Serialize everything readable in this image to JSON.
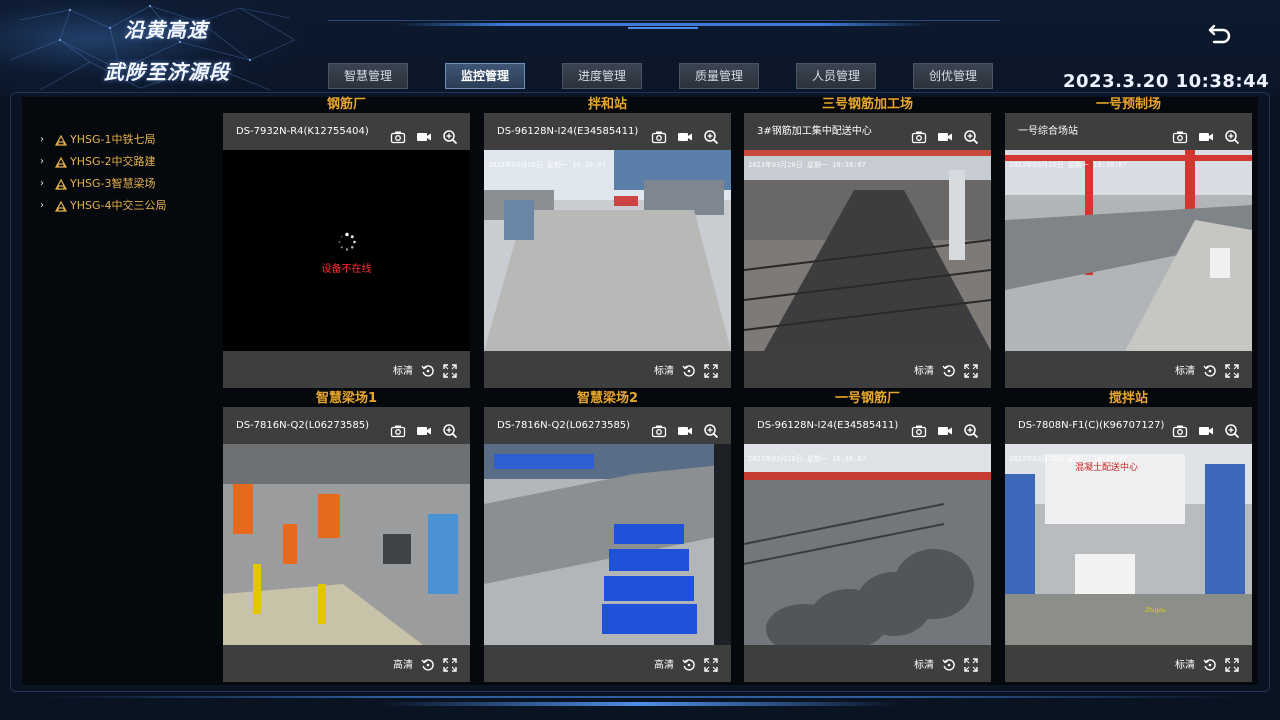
{
  "header": {
    "brand_line1": "沿黄高速",
    "brand_line2": "武陟至济源段",
    "clock": "2023.3.20 10:38:44",
    "nav": [
      {
        "label": "智慧管理",
        "active": false
      },
      {
        "label": "监控管理",
        "active": true
      },
      {
        "label": "进度管理",
        "active": false
      },
      {
        "label": "质量管理",
        "active": false
      },
      {
        "label": "人员管理",
        "active": false
      },
      {
        "label": "创优管理",
        "active": false
      }
    ]
  },
  "tree": [
    {
      "label": "YHSG-1中铁七局"
    },
    {
      "label": "YHSG-2中交路建"
    },
    {
      "label": "YHSG-3智慧梁场"
    },
    {
      "label": "YHSG-4中交三公局"
    }
  ],
  "cameras": [
    {
      "title": "钢筋厂",
      "device": "DS-7932N-R4(K12755404)",
      "quality": "标清",
      "osd": "",
      "offline": true,
      "status": "设备不在线",
      "scene": "none"
    },
    {
      "title": "拌和站",
      "device": "DS-96128N-I24(E34585411)",
      "quality": "标清",
      "osd": "2023年03月20日 星期一 10:38:07",
      "offline": false,
      "scene": "yard"
    },
    {
      "title": "三号钢筋加工场",
      "device": "3#钢筋加工集中配送中心",
      "quality": "标清",
      "osd": "2023年03月20日 星期一 10:38:07",
      "offline": false,
      "scene": "rebar"
    },
    {
      "title": "一号预制场",
      "device": "一号综合场站",
      "quality": "标清",
      "osd": "2023年03月20日 星期一 10:38:07",
      "offline": false,
      "scene": "precast"
    },
    {
      "title": "智慧梁场1",
      "device": "DS-7816N-Q2(L06273585)",
      "quality": "高清",
      "osd": "",
      "offline": false,
      "scene": "factory"
    },
    {
      "title": "智慧梁场2",
      "device": "DS-7816N-Q2(L06273585)",
      "quality": "高清",
      "osd": "",
      "offline": false,
      "scene": "blue"
    },
    {
      "title": "一号钢筋厂",
      "device": "DS-96128N-I24(E34585411)",
      "quality": "标清",
      "osd": "2023年03月20日 星期一 10:38:07",
      "offline": false,
      "scene": "coil"
    },
    {
      "title": "搅拌站",
      "device": "DS-7808N-F1(C)(K96707127)",
      "quality": "标清",
      "osd": "2023年03月20日 星期一 10:38:07",
      "offline": false,
      "scene": "mix"
    }
  ],
  "colors": {
    "accent_title": "#e8a62a",
    "tree_text": "#e6b24d",
    "offline_red": "#ff3030",
    "bg": "#0a1322"
  },
  "icons": {
    "camera_header": [
      "snapshot-icon",
      "record-icon",
      "zoom-in-icon"
    ],
    "camera_footer": [
      "replay-icon",
      "fullscreen-icon"
    ],
    "top_right": "back-icon"
  }
}
